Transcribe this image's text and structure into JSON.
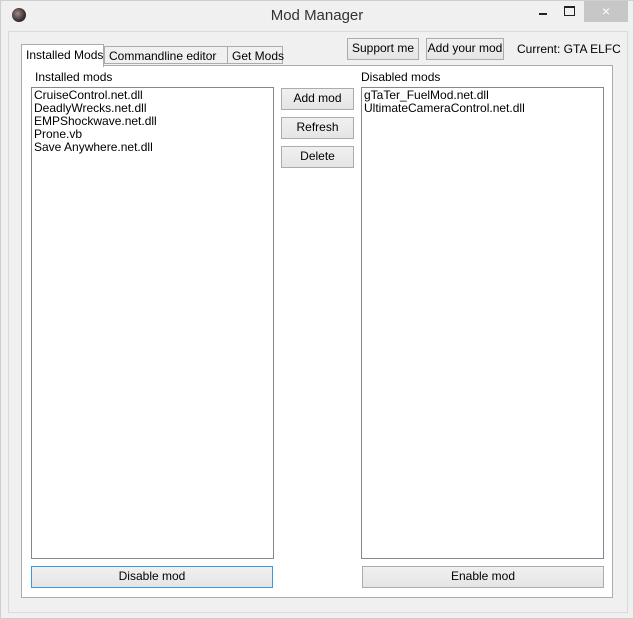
{
  "window": {
    "title": "Mod Manager",
    "controls": {
      "minimize": "minimize",
      "maximize": "maximize",
      "close": "×"
    }
  },
  "header": {
    "support_label": "Support me",
    "add_your_mod_label": "Add your mod",
    "current_game": "Current: GTA ELFC"
  },
  "tabs": [
    {
      "label": "Installed Mods",
      "active": true
    },
    {
      "label": "Commandline editor",
      "active": false
    },
    {
      "label": "Get Mods",
      "active": false
    }
  ],
  "installed": {
    "title": "Installed mods",
    "items": [
      "CruiseControl.net.dll",
      "DeadlyWrecks.net.dll",
      "EMPShockwave.net.dll",
      "Prone.vb",
      "Save Anywhere.net.dll"
    ],
    "action_label": "Disable mod"
  },
  "disabled": {
    "title": "Disabled mods",
    "items": [
      "gTaTer_FuelMod.net.dll",
      "UltimateCameraControl.net.dll"
    ],
    "action_label": "Enable mod"
  },
  "middle_buttons": {
    "add": "Add mod",
    "refresh": "Refresh",
    "delete": "Delete"
  }
}
